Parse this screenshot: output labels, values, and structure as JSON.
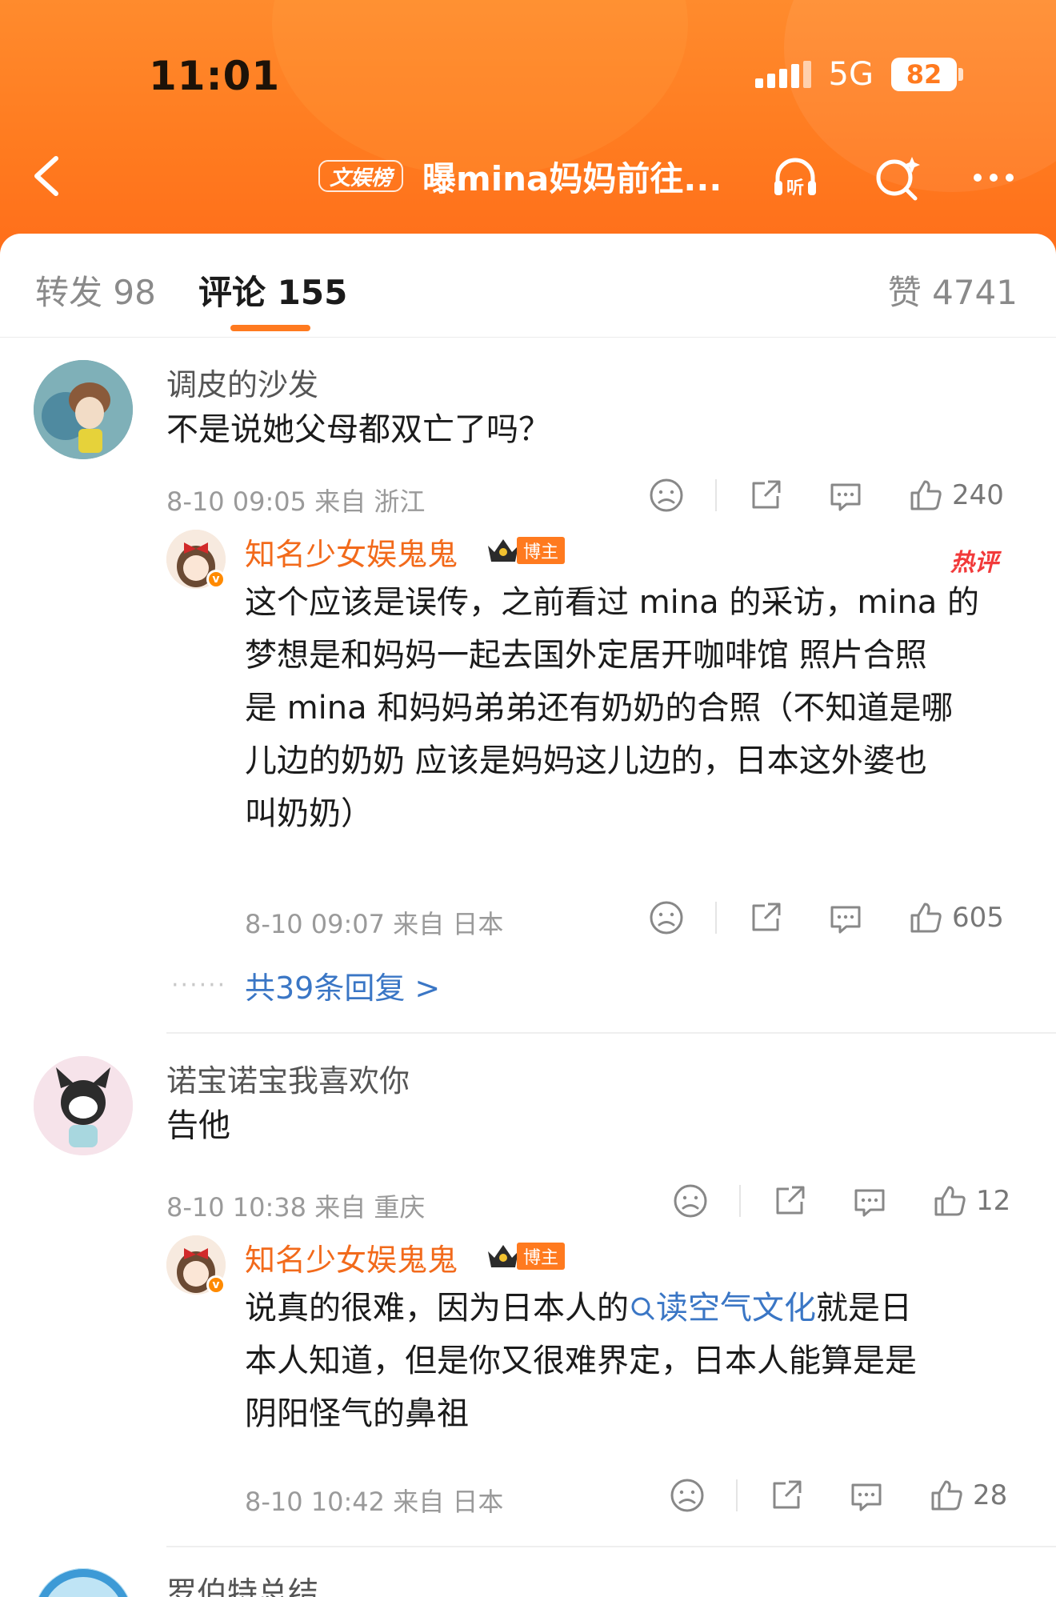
{
  "status_bar": {
    "time": "11:01",
    "network": "5G",
    "battery": "82"
  },
  "nav": {
    "tag": "文娱榜",
    "title": "曝mina妈妈前往...",
    "listen_label": "听"
  },
  "tabs": {
    "repost": "转发 98",
    "comments": "评论 155",
    "likes": "赞 4741"
  },
  "comments": [
    {
      "user": "调皮的沙发",
      "text": "不是说她父母都双亡了吗？",
      "meta": "8-10 09:05  来自 浙江",
      "likes": "240",
      "reply": {
        "user": "知名少女娱鬼鬼",
        "badge": "博主",
        "hot": "热评",
        "lines": [
          "这个应该是误传，之前看过 mina 的采访，mina 的",
          "梦想是和妈妈一起去国外定居开咖啡馆 照片合照",
          "是 mina 和妈妈弟弟还有奶奶的合照（不知道是哪",
          "儿边的奶奶 应该是妈妈这儿边的，日本这外婆也",
          "叫奶奶）"
        ],
        "meta": "8-10 09:07  来自 日本",
        "likes": "605"
      },
      "more_replies": "共39条回复 >"
    },
    {
      "user": "诺宝诺宝我喜欢你",
      "text": "告他",
      "meta": "8-10 10:38  来自 重庆",
      "likes": "12",
      "reply": {
        "user": "知名少女娱鬼鬼",
        "badge": "博主",
        "line1_pre": "说真的很难，因为日本人的",
        "keyword": "读空气文化",
        "line1_post": "就是日",
        "lines": [
          "本人知道，但是你又很难界定，日本人能算是是",
          "阴阳怪气的鼻祖"
        ],
        "meta": "8-10 10:42  来自 日本",
        "likes": "28"
      }
    },
    {
      "user": "罗伯特总结"
    }
  ],
  "icons": [
    "back-arrow-icon",
    "listen-headphone-icon",
    "search-sparkle-icon",
    "more-dots-icon",
    "dislike-face-icon",
    "share-icon",
    "comment-icon",
    "thumbs-up-icon",
    "crown-icon"
  ],
  "colors": {
    "header": "#ff7a1f",
    "accent": "#f26a1b",
    "link": "#3a76c5",
    "hot": "#f23a3a"
  }
}
